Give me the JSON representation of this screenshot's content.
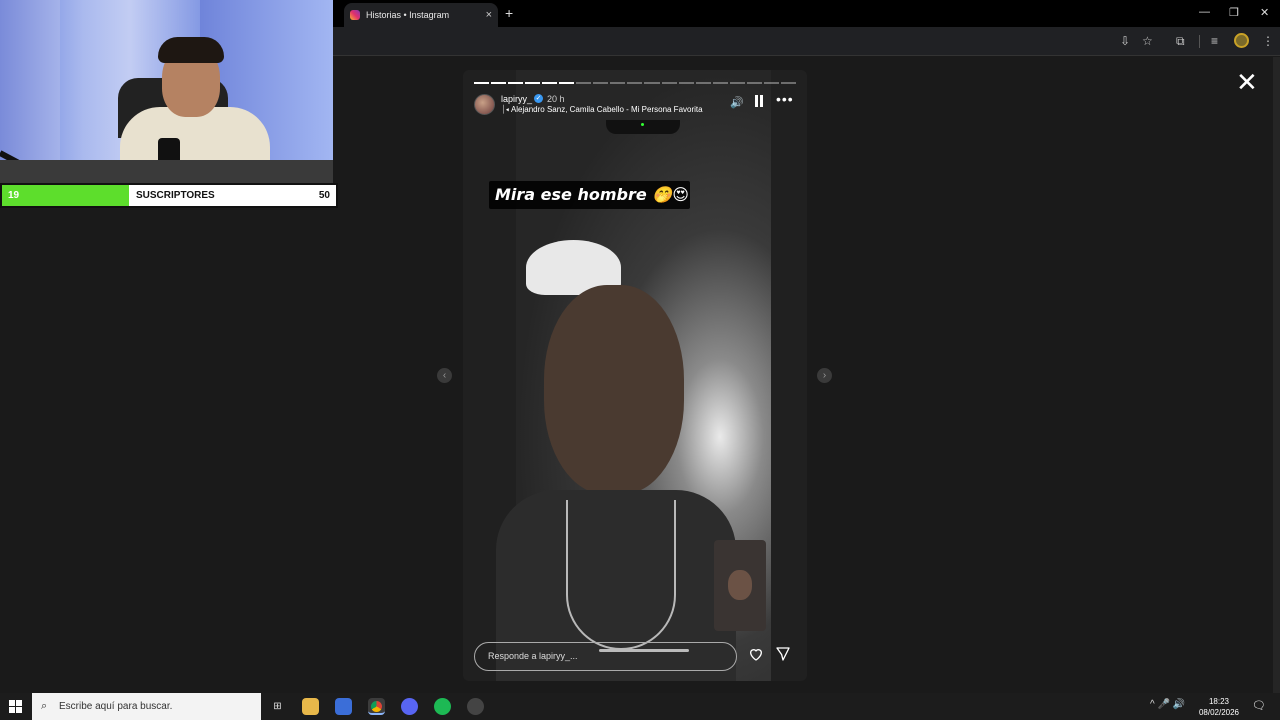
{
  "browser": {
    "tab_title": "Historias • Instagram",
    "tab_close": "×",
    "new_tab": "+",
    "window_controls": [
      "—",
      "❐",
      "✕"
    ],
    "toolbar_icons": [
      "⇩",
      "☆",
      "⧉",
      "≡",
      "⋮"
    ]
  },
  "stream_overlay": {
    "subs_current": "19",
    "subs_label": "SUSCRIPTORES",
    "subs_goal": "50",
    "progress_fraction": 0.38,
    "colors": {
      "fill": "#5dde2c",
      "track": "#ffffff"
    }
  },
  "story": {
    "username": "lapiryy_",
    "verified": "✓",
    "time_ago": "20 h",
    "music_icon": "⏐◂",
    "music_artists": "Alejandro Sanz, Camila Cabello",
    "music_separator": " - ",
    "music_song": "Mi Persona Favorita",
    "caption": "Mira ese hombre 🤭😍",
    "reply_placeholder": "Responde a lapiryy_...",
    "segments_total": 19,
    "segments_done": 6,
    "volume_icon": "🔊",
    "more_icon": "•••",
    "prev_arrow": "‹",
    "next_arrow": "›",
    "close_icon": "✕"
  },
  "taskbar": {
    "search_placeholder": "Escribe aquí para buscar.",
    "search_icon": "⌕",
    "tray": "^  🎤 🔊",
    "time": "18:23",
    "date": "08/02/2026",
    "notifications": "🗨"
  }
}
